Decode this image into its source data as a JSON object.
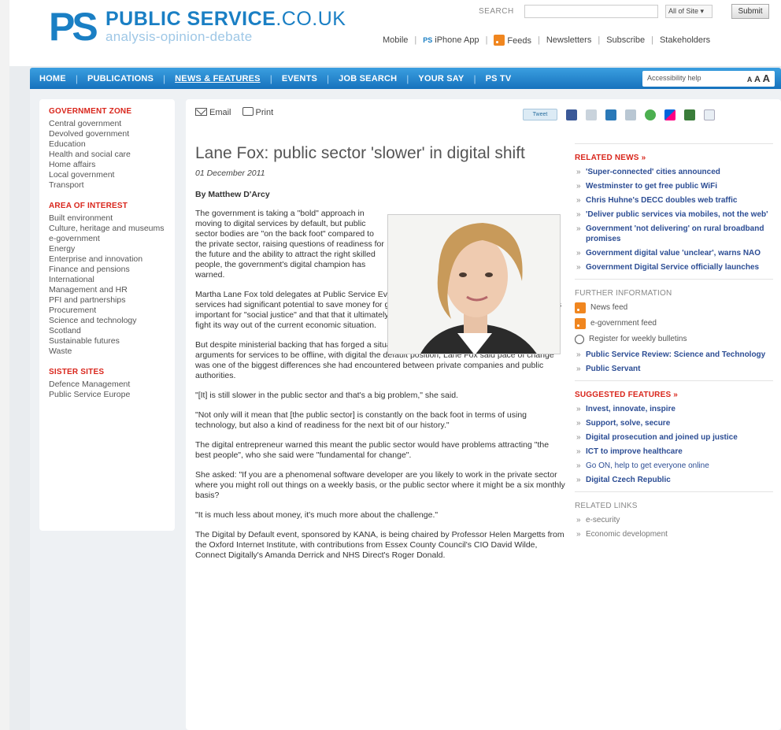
{
  "header": {
    "logo_mark": "PS",
    "site_name_bold": "PUBLIC SERVICE",
    "site_name_suffix": ".CO.UK",
    "tagline": "analysis-opinion-debate",
    "search_label": "SEARCH",
    "search_scope": "All of Site",
    "search_submit": "Submit",
    "links": [
      "Mobile",
      "iPhone App",
      "Feeds",
      "Newsletters",
      "Subscribe",
      "Stakeholders"
    ]
  },
  "nav": {
    "items": [
      "HOME",
      "PUBLICATIONS",
      "NEWS & FEATURES",
      "EVENTS",
      "JOB SEARCH",
      "YOUR SAY",
      "PS TV"
    ],
    "accessibility_label": "Accessibility help",
    "text_size": [
      "A",
      "A",
      "A"
    ]
  },
  "sidebar": {
    "government_zone": {
      "heading": "GOVERNMENT ZONE",
      "items": [
        "Central government",
        "Devolved government",
        "Education",
        "Health and social care",
        "Home affairs",
        "Local government",
        "Transport"
      ]
    },
    "area_of_interest": {
      "heading": "AREA OF INTEREST",
      "items": [
        "Built environment",
        "Culture, heritage and museums",
        "e-government",
        "Energy",
        "Enterprise and innovation",
        "Finance and pensions",
        "International",
        "Management and HR",
        "PFI and partnerships",
        "Procurement",
        "Science and technology",
        "Scotland",
        "Sustainable futures",
        "Waste"
      ]
    },
    "sister_sites": {
      "heading": "SISTER SITES",
      "items": [
        "Defence Management",
        "Public Service Europe"
      ]
    }
  },
  "toolbar": {
    "email_label": "Email",
    "print_label": "Print",
    "tweet_label": "Tweet"
  },
  "article": {
    "title": "Lane Fox: public sector 'slower' in digital shift",
    "date": "01 December 2011",
    "byline": "By Matthew D'Arcy",
    "paragraphs": [
      "The government is taking a \"bold\" approach in moving to digital services by default, but public sector bodies are \"on the back foot\" compared to the private sector, raising questions of readiness for the future and the ability to attract the right skilled people, the government's digital champion has warned.",
      "Martha Lane Fox told delegates at Public Service Events' Digital by Default conference that digital services had significant potential to save money for government. More than this, she said digital was important for \"social justice\" and that that it ultimately offered the UK one of the few opportunities to fight its way out of the current economic situation.",
      "But despite ministerial backing that has forged a situation where civil servants must now present arguments for services to be offline, with digital the default position, Lane Fox said pace of change was one of the biggest differences she had encountered between private companies and public authorities.",
      "\"[It] is still slower in the public sector and that's a big problem,\" she said.",
      "\"Not only will it mean that [the public sector] is constantly on the back foot in terms of using technology, but also a kind of readiness for the next bit of our history.\"",
      "The digital entrepreneur warned this meant the public sector would have problems attracting \"the best people\", who she said were \"fundamental for change\".",
      "She asked: \"If you are a phenomenal software developer are you likely to work in the private sector where you might roll out things on a weekly basis, or the public sector where it might be a six monthly basis?",
      "\"It is much less about money, it's much more about the challenge.\"",
      "The Digital by Default event, sponsored by KANA, is being chaired by Professor Helen Margetts from the Oxford Internet Institute, with contributions from Essex County Council's CIO David Wilde, Connect Digitally's Amanda Derrick and NHS Direct's Roger Donald."
    ]
  },
  "related_news": {
    "heading": "RELATED NEWS »",
    "items": [
      "'Super-connected' cities announced",
      "Westminster to get free public WiFi",
      "Chris Huhne's DECC doubles web traffic",
      "'Deliver public services via mobiles, not the web'",
      "Government 'not delivering' on rural broadband promises",
      "Government digital value 'unclear', warns NAO",
      "Government Digital Service officially launches"
    ]
  },
  "further_info": {
    "heading": "FURTHER INFORMATION",
    "news_feed": "News feed",
    "egov_feed": "e-government feed",
    "register": "Register for weekly bulletins",
    "links": [
      "Public Service Review: Science and Technology",
      "Public Servant"
    ]
  },
  "suggested": {
    "heading": "SUGGESTED FEATURES »",
    "items": [
      "Invest, innovate, inspire",
      "Support, solve, secure",
      "Digital prosecution and joined up justice",
      "ICT to improve healthcare",
      "Go ON, help to get everyone online",
      "Digital Czech Republic"
    ]
  },
  "related_links": {
    "heading": "RELATED LINKS",
    "items": [
      "e-security",
      "Economic development"
    ]
  },
  "colors": {
    "brand_blue": "#1a7fc4",
    "nav_blue": "#1672bd",
    "accent_red": "#d9261c",
    "link_navy": "#2c4d94"
  }
}
